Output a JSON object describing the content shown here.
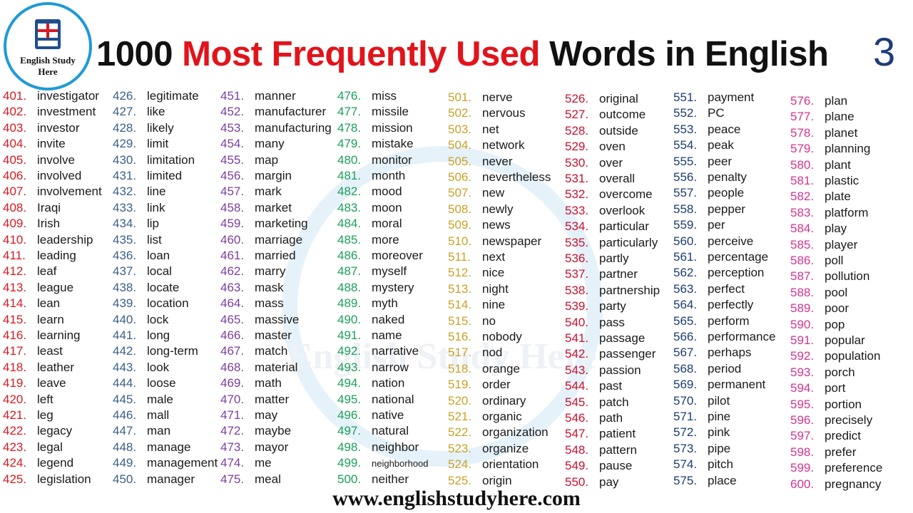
{
  "logo": {
    "text": "English Study Here"
  },
  "watermark": {
    "text": "English Study Here"
  },
  "title": {
    "count": "1000",
    "highlight": "Most Frequently Used",
    "rest": "Words in English"
  },
  "part_number": "3",
  "footer": "www.englishstudyhere.com",
  "columns": [
    {
      "color": "#d71920",
      "start": 401,
      "words": [
        "investigator",
        "investment",
        "investor",
        "invite",
        "involve",
        "involved",
        "involvement",
        "Iraqi",
        "Irish",
        "leadership",
        "leading",
        "leaf",
        "league",
        "lean",
        "learn",
        "learning",
        "least",
        "leather",
        "leave",
        "left",
        "leg",
        "legacy",
        "legal",
        "legend",
        "legislation"
      ]
    },
    {
      "color": "#3a5f86",
      "start": 426,
      "words": [
        "legitimate",
        "like",
        "likely",
        "limit",
        "limitation",
        "limited",
        "line",
        "link",
        "lip",
        "list",
        "loan",
        "local",
        "locate",
        "location",
        "lock",
        "long",
        "long-term",
        "look",
        "loose",
        "male",
        "mall",
        "man",
        "manage",
        "management",
        "manager"
      ]
    },
    {
      "color": "#7b3f9e",
      "start": 451,
      "words": [
        "manner",
        "manufacturer",
        "manufacturing",
        "many",
        "map",
        "margin",
        "mark",
        "market",
        "marketing",
        "marriage",
        "married",
        "marry",
        "mask",
        "mass",
        "massive",
        "master",
        "match",
        "material",
        "math",
        "matter",
        "may",
        "maybe",
        "mayor",
        "me",
        "meal"
      ]
    },
    {
      "color": "#1aa05a",
      "start": 476,
      "words": [
        "miss",
        "missile",
        "mission",
        "mistake",
        "monitor",
        "month",
        "mood",
        "moon",
        "moral",
        "more",
        "moreover",
        "myself",
        "mystery",
        "myth",
        "naked",
        "name",
        "narrative",
        "narrow",
        "nation",
        "national",
        "native",
        "natural",
        "neighbor",
        "neighborhood",
        "neither"
      ]
    },
    {
      "color": "#c9a227",
      "start": 501,
      "words": [
        "nerve",
        "nervous",
        "net",
        "network",
        "never",
        "nevertheless",
        "new",
        "newly",
        "news",
        "newspaper",
        "next",
        "nice",
        "night",
        "nine",
        "no",
        "nobody",
        "nod",
        "orange",
        "order",
        "ordinary",
        "organic",
        "organization",
        "organize",
        "orientation",
        "origin"
      ]
    },
    {
      "color": "#c8102e",
      "start": 526,
      "words": [
        "original",
        "outcome",
        "outside",
        "oven",
        "over",
        "overall",
        "overcome",
        "overlook",
        "particular",
        "particularly",
        "partly",
        "partner",
        "partnership",
        "party",
        "pass",
        "passage",
        "passenger",
        "passion",
        "past",
        "patch",
        "path",
        "patient",
        "pattern",
        "pause",
        "pay"
      ]
    },
    {
      "color": "#1c3d6e",
      "start": 551,
      "words": [
        "payment",
        "PC",
        "peace",
        "peak",
        "peer",
        "penalty",
        "people",
        "pepper",
        "per",
        "perceive",
        "percentage",
        "perception",
        "perfect",
        "perfectly",
        "perform",
        "performance",
        "perhaps",
        "period",
        "permanent",
        "pilot",
        "pine",
        "pink",
        "pipe",
        "pitch",
        "place"
      ]
    },
    {
      "color": "#d6338f",
      "start": 576,
      "words": [
        "plan",
        "plane",
        "planet",
        "planning",
        "plant",
        "plastic",
        "plate",
        "platform",
        "play",
        "player",
        "poll",
        "pollution",
        "pool",
        "poor",
        "pop",
        "popular",
        "population",
        "porch",
        "port",
        "portion",
        "precisely",
        "predict",
        "prefer",
        "preference",
        "pregnancy"
      ]
    }
  ]
}
